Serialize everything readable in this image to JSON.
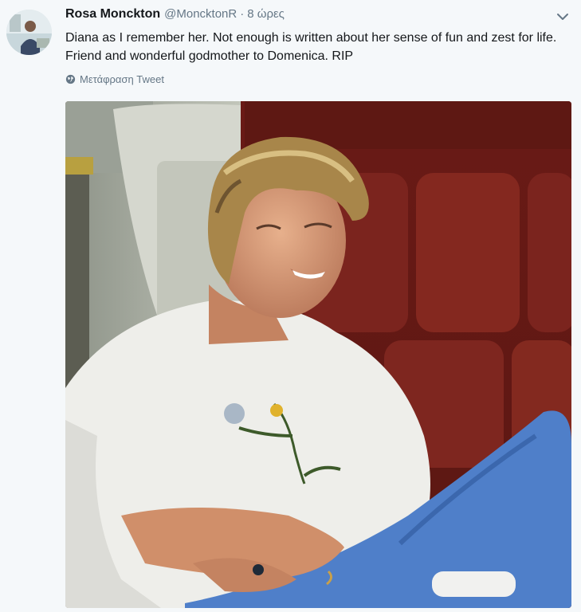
{
  "tweet": {
    "display_name": "Rosa Monckton",
    "handle": "@MoncktonR",
    "separator": "·",
    "time": "8 ώρες",
    "text": "Diana as I remember her. Not enough is written about her sense of fun and zest for life. Friend and wonderful godmother to Domenica. RIP",
    "translate_label": "Μετάφραση Tweet"
  },
  "icons": {
    "menu": "chevron-down-icon",
    "translate": "globe-icon"
  },
  "colors": {
    "name": "#14171a",
    "secondary": "#657786",
    "background": "#f5f8fa"
  }
}
